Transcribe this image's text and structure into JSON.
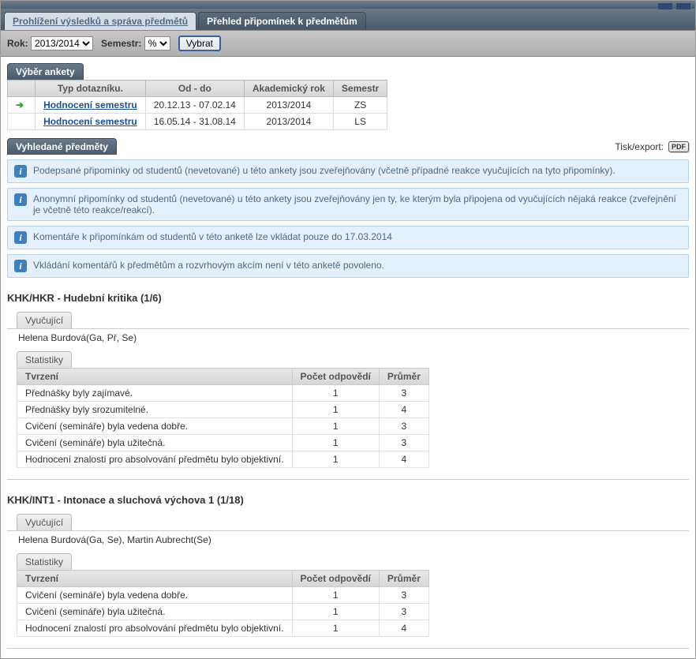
{
  "tabs": {
    "active": "Prohlížení výsledků a správa předmětů",
    "inactive": "Přehled připomínek k předmětům"
  },
  "filter": {
    "year_label": "Rok:",
    "year_value": "2013/2014",
    "semester_label": "Semestr:",
    "semester_value": "%",
    "submit": "Vybrat"
  },
  "survey_section": {
    "title": "Výběr ankety",
    "headers": {
      "type": "Typ dotazníku.",
      "period": "Od - do",
      "year": "Akademický rok",
      "sem": "Semestr"
    },
    "rows": [
      {
        "selected": true,
        "type": "Hodnocení semestru",
        "period": "20.12.13 - 07.02.14",
        "year": "2013/2014",
        "sem": "ZS"
      },
      {
        "selected": false,
        "type": "Hodnocení semestru",
        "period": "16.05.14 - 31.08.14",
        "year": "2013/2014",
        "sem": "LS"
      }
    ]
  },
  "found_section": {
    "title": "Vyhledané předměty",
    "export_label": "Tisk/export:",
    "export_pdf": "PDF"
  },
  "infos": [
    "Podepsané připomínky od studentů (nevetované) u této ankety jsou zveřejňovány (včetně případné reakce vyučujících na tyto připomínky).",
    "Anonymní připomínky od studentů (nevetované) u této ankety jsou zveřejňovány jen ty, ke kterým byla připojena od vyučujících nějaká reakce (zveřejnění je včetně této reakce/reakcí).",
    "Komentáře k připomínkám od studentů v této anketě lze vkládat pouze do 17.03.2014",
    "Vkládání komentářů k předmětům a rozvrhovým akcím není v této anketě povoleno."
  ],
  "labels": {
    "teachers": "Vyučující",
    "stats": "Statistiky",
    "col_statement": "Tvrzení",
    "col_count": "Počet odpovědí",
    "col_avg": "Průměr"
  },
  "courses": [
    {
      "title": "KHK/HKR - Hudební kritika (1/6)",
      "teachers": "Helena Burdová(Ga, Př, Se)",
      "rows": [
        {
          "s": "Přednášky byly zajímavé.",
          "n": "1",
          "a": "3"
        },
        {
          "s": "Přednášky byly srozumitelné.",
          "n": "1",
          "a": "4"
        },
        {
          "s": "Cvičení (semináře) byla vedena dobře.",
          "n": "1",
          "a": "3"
        },
        {
          "s": "Cvičení (semináře) byla užitečná.",
          "n": "1",
          "a": "3"
        },
        {
          "s": "Hodnocení znalostí pro absolvování předmětu bylo objektivní.",
          "n": "1",
          "a": "4"
        }
      ]
    },
    {
      "title": "KHK/INT1 - Intonace a sluchová výchova 1 (1/18)",
      "teachers": "Helena Burdová(Ga, Se), Martin Aubrecht(Se)",
      "rows": [
        {
          "s": "Cvičení (semináře) byla vedena dobře.",
          "n": "1",
          "a": "3"
        },
        {
          "s": "Cvičení (semináře) byla užitečná.",
          "n": "1",
          "a": "3"
        },
        {
          "s": "Hodnocení znalostí pro absolvování předmětu bylo objektivní.",
          "n": "1",
          "a": "4"
        }
      ]
    }
  ]
}
